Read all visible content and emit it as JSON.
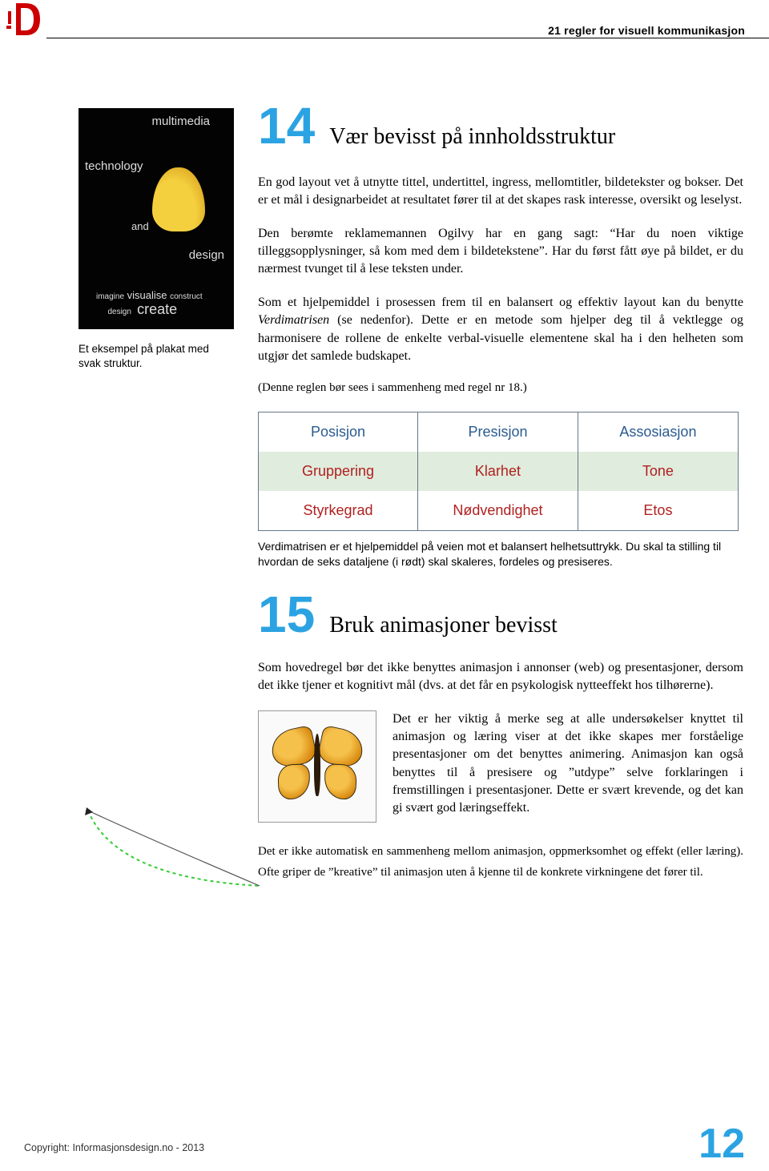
{
  "header": {
    "tagline": "21 regler for visuell kommunikasjon"
  },
  "side": {
    "thumb": {
      "words": [
        "multimedia",
        "technology",
        "and",
        "design"
      ],
      "bottom_line": "imagine visualise design construct create"
    },
    "caption": "Et eksempel på plakat med svak struktur."
  },
  "rule14": {
    "num": "14",
    "title": "Vær bevisst på innholdsstruktur",
    "p1": "En god layout vet å utnytte tittel, undertittel, ingress, mellomtitler, bildetekster og bokser. Det er et mål i designarbeidet at resultatet fører til at det skapes rask interesse, oversikt og leselyst.",
    "p2": "Den berømte reklamemannen Ogilvy har en gang sagt: “Har du noen viktige tilleggsopplysninger, så kom med dem i bildetekstene”. Har du først fått øye på bildet, er du nærmest tvunget til å lese teksten under.",
    "p3_a": "Som et hjelpemiddel i prosessen frem til en balansert og effektiv layout kan du benytte ",
    "p3_italic": "Verdimatrisen",
    "p3_b": " (se nedenfor). Dette er en metode som hjelper deg til å vektlegge og harmonisere de rollene de enkelte verbal-visuelle elementene skal ha i den helheten som utgjør det samlede budskapet.",
    "p4": "(Denne reglen bør sees i sammenheng med regel nr 18.)",
    "matrix": {
      "r1": [
        "Posisjon",
        "Presisjon",
        "Assosiasjon"
      ],
      "r2": [
        "Gruppering",
        "Klarhet",
        "Tone"
      ],
      "r3": [
        "Styrkegrad",
        "Nødvendighet",
        "Etos"
      ]
    },
    "matrix_caption": "Verdimatrisen er et hjelpemiddel på veien mot et balansert helhetsuttrykk. Du skal ta stilling til hvordan de seks dataljene (i rødt) skal skaleres, fordeles og presiseres."
  },
  "rule15": {
    "num": "15",
    "title": "Bruk animasjoner bevisst",
    "p1": "Som hovedregel bør det ikke benyttes animasjon i annonser (web) og presentasjoner, dersom det ikke tjener et kognitivt mål (dvs. at det får en psykologisk nytteeffekt hos tilhørerne).",
    "p2": "Det er her viktig å merke seg at alle undersøkelser knyttet til animasjon og læring viser at det ikke skapes mer forståelige presentasjoner om det benyttes animering. Animasjon kan også benyttes til å presisere og ”utdype” selve forklaringen i fremstillingen i presentasjoner. Dette er svært krevende, og det kan gi svært god læringseffekt.",
    "p3": "Det er ikke automatisk en sammenheng mellom animasjon, oppmerksomhet og effekt (eller læring). Ofte griper de ”kreative” til animasjon uten å kjenne til de konkrete virkningene det fører til."
  },
  "footer": {
    "copyright": "Copyright: Informasjonsdesign.no - 2013",
    "page": "12"
  }
}
